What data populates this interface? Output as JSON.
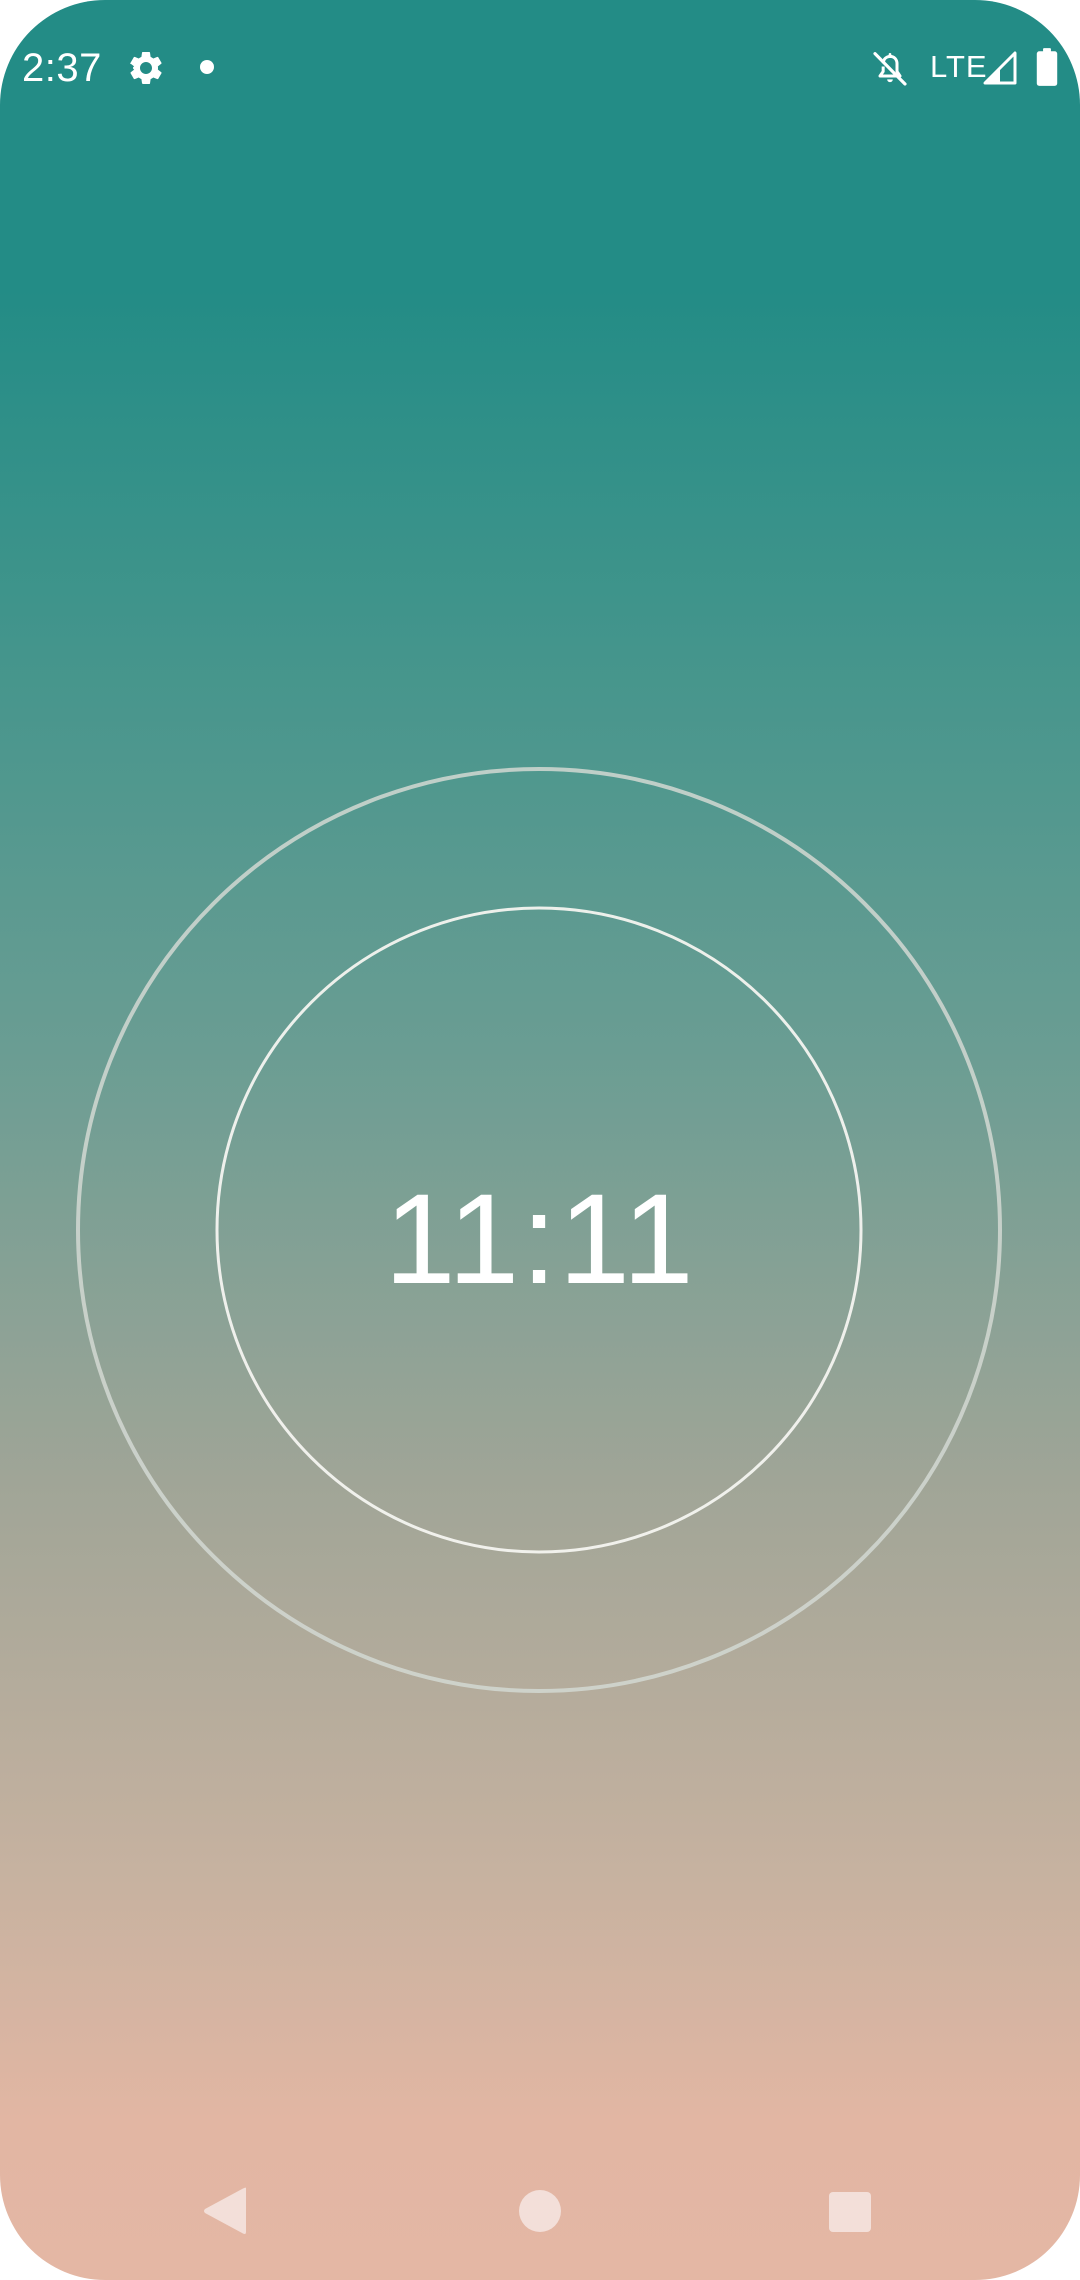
{
  "status_bar": {
    "time": "2:37",
    "icons": [
      "gear-icon",
      "notification-dot-icon",
      "bell-off-icon",
      "signal-icon",
      "battery-icon"
    ],
    "network_label": "LTE"
  },
  "clock": {
    "time": "11:11"
  },
  "nav_bar": {
    "icons": [
      "back-icon",
      "home-icon",
      "recents-icon"
    ]
  },
  "colors": {
    "gradient_top": "#238c86",
    "gradient_bottom": "#e4b7a4",
    "nav_button": "#f3dfd9",
    "ring_outer": "#cfd5cf",
    "ring_inner": "#f2f2ee"
  }
}
